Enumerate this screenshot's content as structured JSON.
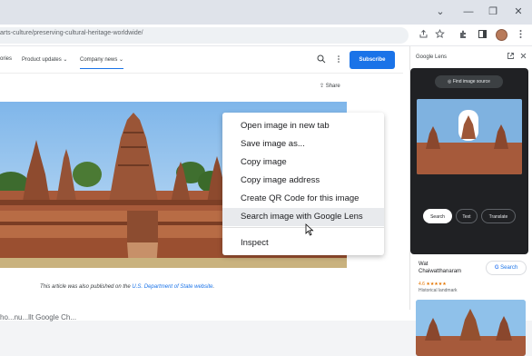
{
  "window": {
    "controls": [
      "⌄",
      "—",
      "❐",
      "✕"
    ]
  },
  "toolbar": {
    "url": "arts-culture/preserving-cultural-heritage-worldwide/",
    "icons": [
      "share-icon",
      "star-icon",
      "extensions-icon",
      "side-panel-icon",
      "profile-avatar",
      "menu-icon"
    ]
  },
  "page": {
    "nav": {
      "items": [
        "ories",
        "Product updates",
        "Company news"
      ],
      "active": "Company news",
      "subscribe_label": "Subscribe"
    },
    "share_label": "Share",
    "caption_prefix": "This article was also published on the",
    "caption_link": "U.S. Department of State website",
    "caption_suffix": "."
  },
  "context_menu": {
    "items": [
      "Open image in new tab",
      "Save image as...",
      "Copy image",
      "Copy image address",
      "Create QR Code for this image",
      "Search image with Google Lens",
      "Inspect"
    ],
    "highlighted": "Search image with Google Lens"
  },
  "lens": {
    "title": "Google Lens",
    "find_source_label": "Find image source",
    "tabs": [
      "Search",
      "Text",
      "Translate"
    ],
    "active_tab": "Search",
    "result": {
      "name_line1": "Wat",
      "name_line2": "Chaiwatthanaram",
      "rating": "4.6 ★★★★★",
      "subtitle": "Historical landmark",
      "search_label": "Search"
    }
  },
  "bottom_caption": "ho...nu...llt Google Ch..."
}
